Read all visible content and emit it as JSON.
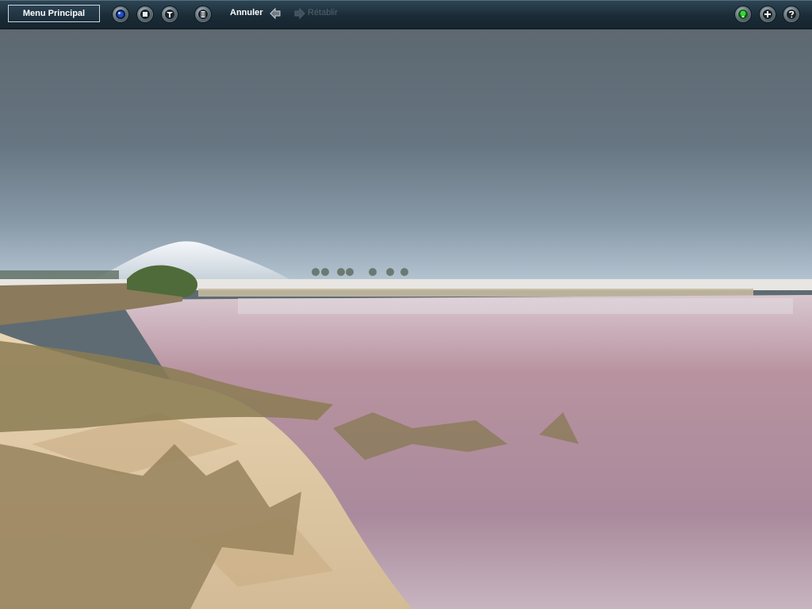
{
  "toolbar": {
    "menu_label": "Menu Principal",
    "undo_label": "Annuler",
    "redo_label": "Rétablir",
    "left_icons": [
      "camera-lens-icon",
      "stop-icon",
      "tools-icon",
      "trash-icon"
    ],
    "right_icons": [
      "bulb-icon",
      "plus-icon",
      "help-icon"
    ]
  },
  "colors": {
    "toolbar": "#1e303c",
    "sky": "#5e6b73",
    "lagoon": "#b695a5",
    "sand": "#dcc4a0",
    "grass": "#8f7d55"
  }
}
